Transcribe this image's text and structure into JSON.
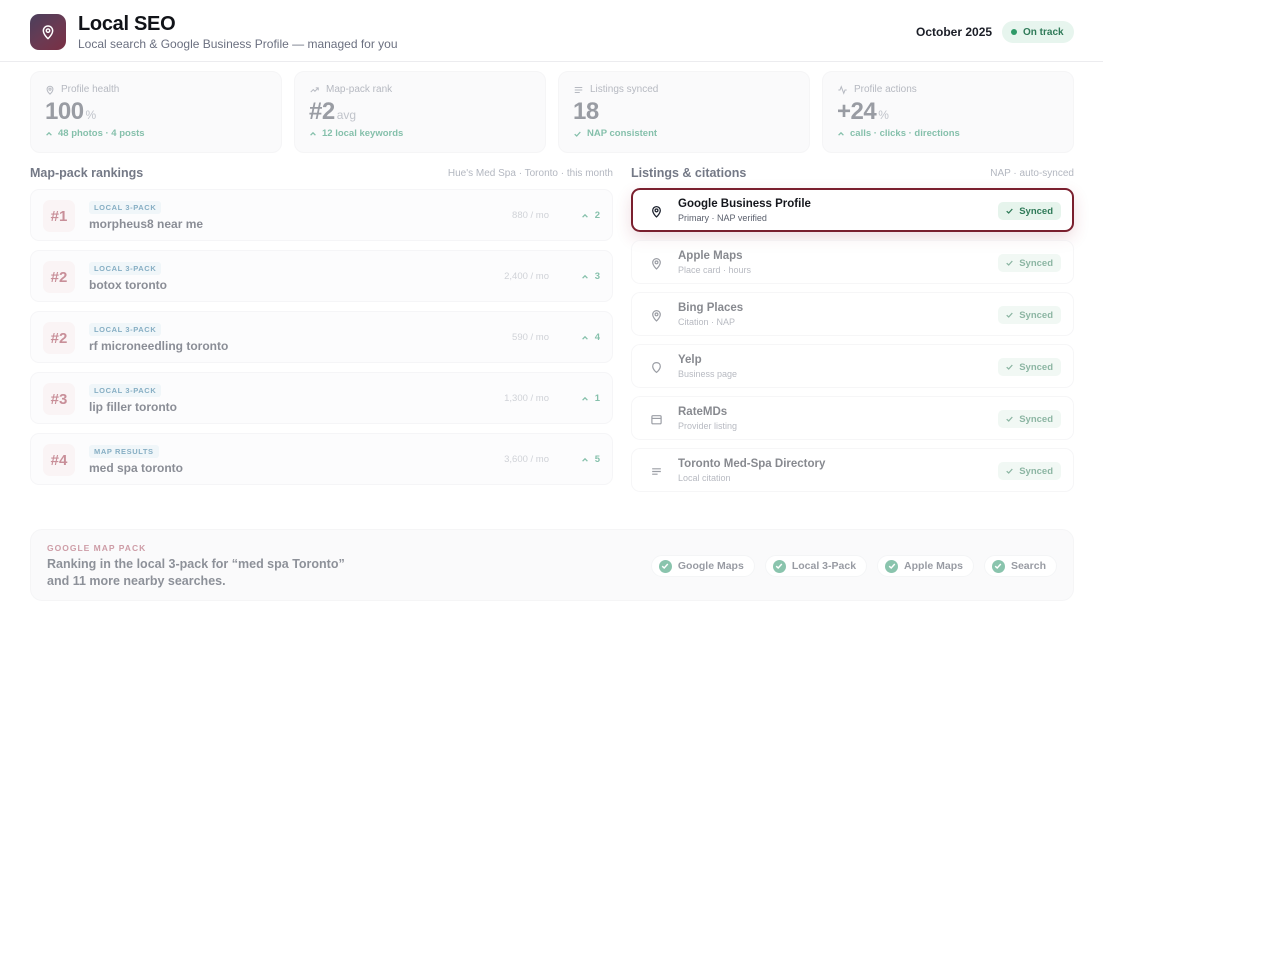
{
  "app": {
    "title": "Local SEO",
    "subtitle": "Local search & Google Business Profile — managed for you",
    "period": "October 2025",
    "status": "On track",
    "logo_icon": "map-pin-icon"
  },
  "kpis": [
    {
      "icon": "map-pin-icon",
      "label": "Profile health",
      "value": "100",
      "unit": "%",
      "note": "48 photos · 4 posts",
      "note_icon": "chevron-up-icon"
    },
    {
      "icon": "trend-up-icon",
      "label": "Map-pack rank",
      "value": "#2",
      "unit": "avg",
      "note": "12 local keywords",
      "note_icon": "chevron-up-icon"
    },
    {
      "icon": "lines-icon",
      "label": "Listings synced",
      "value": "18",
      "unit": "",
      "note": "NAP consistent",
      "note_icon": "check-icon"
    },
    {
      "icon": "activity-icon",
      "label": "Profile actions",
      "value": "+24",
      "unit": "%",
      "note": "calls · clicks · directions",
      "note_icon": "chevron-up-icon"
    }
  ],
  "rankings": {
    "heading": "Map-pack rankings",
    "meta": "Hue's Med Spa · Toronto · this month",
    "rows": [
      {
        "position": "#1",
        "tag": "LOCAL 3-PACK",
        "keyword": "morpheus8 near me",
        "volume": "880 / mo",
        "delta": "2"
      },
      {
        "position": "#2",
        "tag": "LOCAL 3-PACK",
        "keyword": "botox toronto",
        "volume": "2,400 / mo",
        "delta": "3"
      },
      {
        "position": "#2",
        "tag": "LOCAL 3-PACK",
        "keyword": "rf microneedling toronto",
        "volume": "590 / mo",
        "delta": "4"
      },
      {
        "position": "#3",
        "tag": "LOCAL 3-PACK",
        "keyword": "lip filler toronto",
        "volume": "1,300 / mo",
        "delta": "1"
      },
      {
        "position": "#4",
        "tag": "MAP RESULTS",
        "keyword": "med spa toronto",
        "volume": "3,600 / mo",
        "delta": "5"
      }
    ]
  },
  "listings": {
    "heading": "Listings & citations",
    "meta": "NAP · auto-synced",
    "rows": [
      {
        "name": "Google Business Profile",
        "sub": "Primary · NAP verified",
        "status": "Synced",
        "icon": "map-pin-icon"
      },
      {
        "name": "Apple Maps",
        "sub": "Place card · hours",
        "status": "Synced",
        "icon": "map-pin-icon"
      },
      {
        "name": "Bing Places",
        "sub": "Citation · NAP",
        "status": "Synced",
        "icon": "map-pin-icon"
      },
      {
        "name": "Yelp",
        "sub": "Business page",
        "status": "Synced",
        "icon": "shield-icon"
      },
      {
        "name": "RateMDs",
        "sub": "Provider listing",
        "status": "Synced",
        "icon": "calendar-icon"
      },
      {
        "name": "Toronto Med-Spa Directory",
        "sub": "Local citation",
        "status": "Synced",
        "icon": "list-icon"
      }
    ]
  },
  "banner": {
    "kicker": "GOOGLE MAP PACK",
    "line1": "Ranking in the local 3-pack for “med spa Toronto”",
    "line2": "and 11 more nearby searches.",
    "chips": [
      "Google Maps",
      "Local 3-Pack",
      "Apple Maps",
      "Search"
    ]
  }
}
